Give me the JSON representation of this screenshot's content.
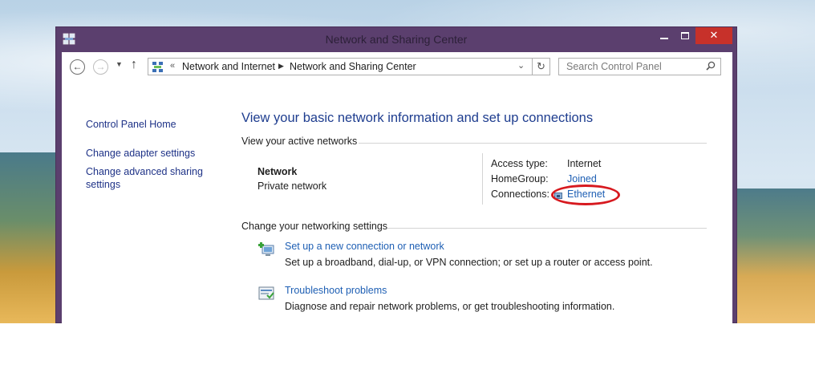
{
  "window": {
    "title": "Network and Sharing Center",
    "close_glyph": "✕"
  },
  "navigation": {
    "back_glyph": "←",
    "forward_glyph": "→",
    "recent_glyph": "▼",
    "up_glyph": "↑",
    "refresh_glyph": "↻"
  },
  "address": {
    "overflow_glyph": "«",
    "breadcrumb": [
      "Network and Internet",
      "Network and Sharing Center"
    ],
    "separator_glyph": "▶",
    "dropdown_glyph": "⌄"
  },
  "search": {
    "placeholder": "Search Control Panel",
    "icon": "search-icon"
  },
  "sidebar": {
    "items": [
      {
        "label": "Control Panel Home"
      },
      {
        "label": "Change adapter settings"
      },
      {
        "label": "Change advanced sharing"
      },
      {
        "label": "settings"
      }
    ]
  },
  "main": {
    "title": "View your basic network information and set up connections",
    "active_networks_heading": "View your active networks",
    "network": {
      "name": "Network",
      "type": "Private network"
    },
    "details": {
      "access_type_label": "Access type:",
      "access_type_value": "Internet",
      "homegroup_label": "HomeGroup:",
      "homegroup_value": "Joined",
      "connections_label": "Connections:",
      "connections_value": "Ethernet"
    },
    "settings_heading": "Change your networking settings",
    "tasks": [
      {
        "icon": "new-connection-icon",
        "link": "Set up a new connection or network",
        "description": "Set up a broadband, dial-up, or VPN connection; or set up a router or access point."
      },
      {
        "icon": "troubleshoot-icon",
        "link": "Troubleshoot problems",
        "description": "Diagnose and repair network problems, or get troubleshooting information."
      }
    ]
  },
  "colors": {
    "window_frame": "#5b3f6e",
    "close_button": "#c7312a",
    "link": "#1e5fb4",
    "title_blue": "#1e3d8f",
    "highlight": "#d7191f"
  }
}
